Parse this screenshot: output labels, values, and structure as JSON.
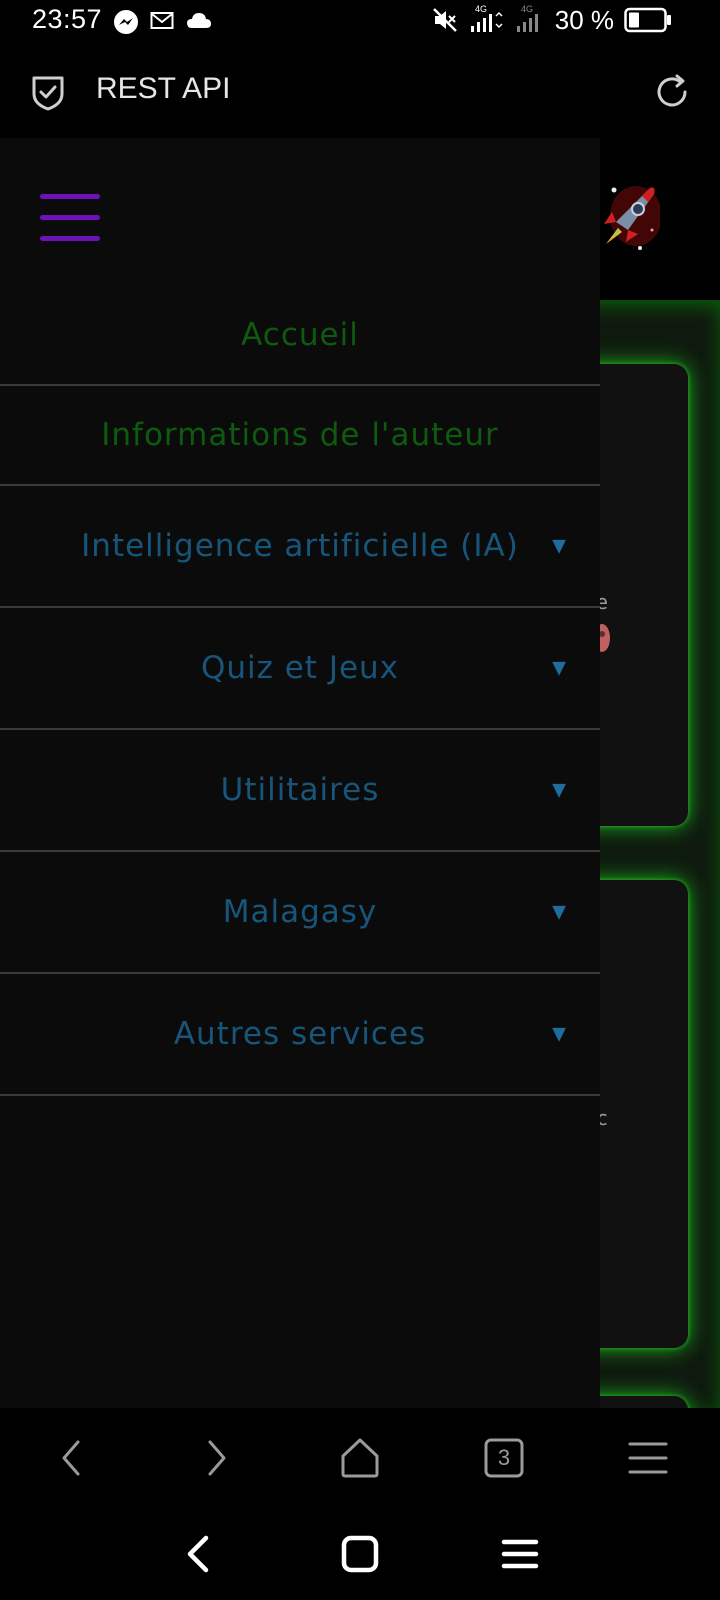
{
  "status_bar": {
    "time": "23:57",
    "battery_percent": "30 %",
    "network_label_1": "4G",
    "network_label_2": "4G",
    "icons": [
      "messenger-icon",
      "mail-icon",
      "cloud-icon",
      "mute-icon",
      "signal-icon",
      "battery-icon"
    ]
  },
  "app_bar": {
    "title": "REST API",
    "icons": [
      "shield-icon",
      "reload-icon"
    ]
  },
  "drawer": {
    "menu_items": [
      {
        "label": "Accueil",
        "color": "#0e5a0e",
        "has_submenu": false
      },
      {
        "label": "Informations de l'auteur",
        "color": "#0e5a0e",
        "has_submenu": false
      },
      {
        "label": "Intelligence artificielle (IA)",
        "color": "#17557a",
        "has_submenu": true,
        "caret": "▼"
      },
      {
        "label": "Quiz et Jeux",
        "color": "#17557a",
        "has_submenu": true,
        "caret": "▼"
      },
      {
        "label": "Utilitaires",
        "color": "#17557a",
        "has_submenu": true,
        "caret": "▼"
      },
      {
        "label": "Malagasy",
        "color": "#17557a",
        "has_submenu": true,
        "caret": "▼"
      },
      {
        "label": "Autres services",
        "color": "#17557a",
        "has_submenu": true,
        "caret": "▼"
      }
    ],
    "hamburger_color": "#6d12b8"
  },
  "background_page": {
    "card_fragments": [
      "e",
      "c"
    ]
  },
  "browser_toolbar": {
    "tab_count": "3",
    "icons": [
      "back-icon",
      "forward-icon",
      "home-icon",
      "tabs-icon",
      "menu-icon"
    ]
  },
  "system_nav": {
    "icons": [
      "nav-back-icon",
      "nav-home-icon",
      "nav-recents-icon"
    ]
  },
  "colors": {
    "accent_glow": "#1fb81f",
    "menu_green": "#0e5a0e",
    "menu_blue": "#17557a"
  }
}
